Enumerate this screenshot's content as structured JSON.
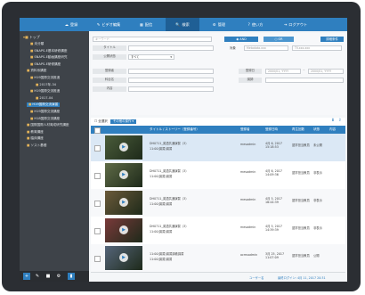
{
  "nav": {
    "items": [
      {
        "label": "登録",
        "icon": "☁"
      },
      {
        "label": "ビデオ編集",
        "icon": "✎"
      },
      {
        "label": "配信",
        "icon": "▦"
      },
      {
        "label": "検索",
        "icon": "🔍"
      },
      {
        "label": "管理",
        "icon": "⚙"
      },
      {
        "label": "使い方",
        "icon": "?"
      },
      {
        "label": "ログアウト",
        "icon": "⇥"
      }
    ]
  },
  "tree": {
    "root": "トップ",
    "items": [
      {
        "label": "未分類"
      },
      {
        "label": "SNAPS-E基本研修講座"
      },
      {
        "label": "SNAPS-E動画講座研究"
      },
      {
        "label": "SNAPS-E研修講座"
      },
      {
        "label": "資料系講座"
      },
      {
        "label": "H19国際交流推進"
      },
      {
        "label": "2017年-34"
      },
      {
        "label": "H19国際交流推進"
      },
      {
        "label": "2017-04"
      },
      {
        "label": "H19国際交流演習"
      },
      {
        "label": "H19国際交流講座"
      },
      {
        "label": "H18国際交流講座"
      },
      {
        "label": "国際国際人材育成研究講座"
      },
      {
        "label": "教育講座"
      },
      {
        "label": "臨床講座"
      },
      {
        "label": "ソスト基礎"
      }
    ],
    "selected_index": 9
  },
  "search": {
    "keyword_placeholder": "キーワード",
    "and_label": "AND",
    "or_label": "OR",
    "clear_label": "詳細条件",
    "title_label": "タイトル",
    "target_label": "対象",
    "target_placeholder": "Metadata.xxx",
    "target2_placeholder": "TV.xxx.xxx",
    "public_label": "公開状態",
    "public_value": "すべて",
    "registrant_label": "登録者",
    "reg_date_label": "登録日",
    "date_from": "2000/01, YYYY",
    "date_to": "2000/01, YYYY",
    "subject_label": "科目名",
    "lecturer_label": "講師",
    "content_label": "内容"
  },
  "results": {
    "tool_select": "全選択",
    "tool_action": "その他の操作",
    "headers": [
      "タイトル / ストーリー（登録番号）",
      "登録者",
      "登録日時",
      "再生回数",
      "状態",
      "内容"
    ],
    "rows": [
      {
        "title": "DH0711_英語共通演習（3）",
        "sub": "11:00(講習)講習",
        "user": "mesadmin",
        "date": "4月 6, 2017 15:18:53",
        "col4": "語学担当教員",
        "col5": "未公開",
        "thumb": "#4a5c3a",
        "selected": true
      },
      {
        "title": "DH0711_英語共通演習（3）",
        "sub": "11:00(講習)講習",
        "user": "mesadmin",
        "date": "4月 6, 2017 14:09:36",
        "col4": "語学担当教員",
        "col5": "非表示",
        "thumb": "#5e6a46",
        "selected": false
      },
      {
        "title": "DH0711_英語共通演習（3）",
        "sub": "11:00(講習)講習",
        "user": "mesadmin",
        "date": "4月 5, 2017 16:44:39",
        "col4": "語学担当教員",
        "col5": "非表示",
        "thumb": "#6b5a3a",
        "selected": false
      },
      {
        "title": "DH0711_英語共通演習（3）",
        "sub": "11:00(講習)講習",
        "user": "mesadmin",
        "date": "4月 5, 2017 14:39:39",
        "col4": "語学担当教員",
        "col5": "非表示",
        "thumb": "#7a3a3a",
        "selected": false
      },
      {
        "title": "11:00(講習)講習講義講習",
        "sub": "11:00(講習)講習",
        "user": "ocmsadmin",
        "date": "3月 25, 2017 11:07:09",
        "col4": "語学担当教員",
        "col5": "公開",
        "thumb": "#55657a",
        "selected": false
      }
    ]
  },
  "status": {
    "user": "ユーザー名",
    "login": "最終ログイン: 4月 11, 2017 20:31"
  },
  "colors": {
    "accent": "#2f7fbf",
    "sidebar": "#3e4349"
  }
}
